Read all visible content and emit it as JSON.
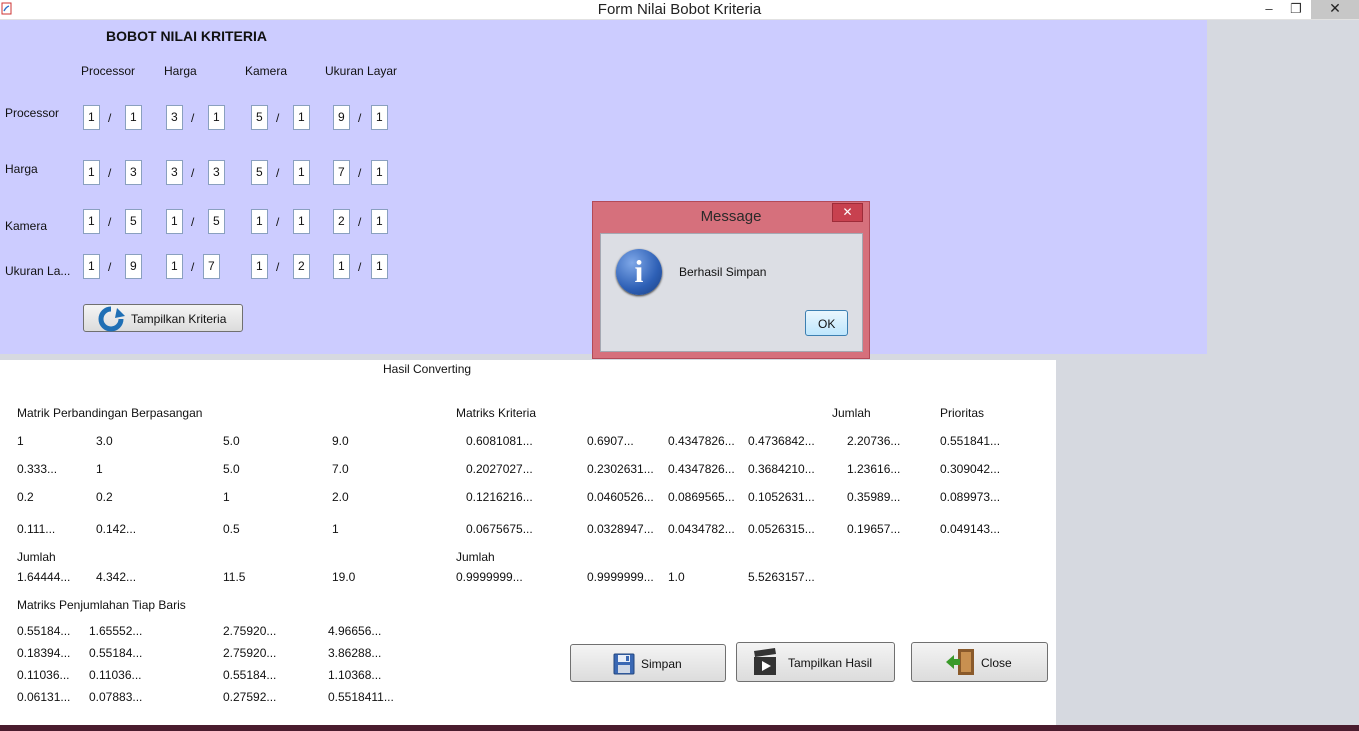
{
  "window": {
    "title": "Form Nilai Bobot Kriteria",
    "minimize": "–",
    "restore": "❐",
    "close": "✕"
  },
  "form": {
    "heading": "BOBOT NILAI KRITERIA",
    "col_headers": [
      "Processor",
      "Harga",
      "Kamera",
      "Ukuran Layar"
    ],
    "row_labels": [
      "Processor",
      "Harga",
      "Kamera",
      "Ukuran La..."
    ],
    "slash": "/",
    "rows": [
      [
        [
          "1",
          "1"
        ],
        [
          "3",
          "1"
        ],
        [
          "5",
          "1"
        ],
        [
          "9",
          "1"
        ]
      ],
      [
        [
          "1",
          "3"
        ],
        [
          "3",
          "3"
        ],
        [
          "5",
          "1"
        ],
        [
          "7",
          "1"
        ]
      ],
      [
        [
          "1",
          "5"
        ],
        [
          "1",
          "5"
        ],
        [
          "1",
          "1"
        ],
        [
          "2",
          "1"
        ]
      ],
      [
        [
          "1",
          "9"
        ],
        [
          "1",
          "7"
        ],
        [
          "1",
          "2"
        ],
        [
          "1",
          "1"
        ]
      ]
    ],
    "tampilkan_kriteria": "Tampilkan Kriteria"
  },
  "hasil": {
    "title": "Hasil Converting",
    "matrik_title": "Matrik Perbandingan Berpasangan",
    "matrik_rows": [
      [
        "1",
        "3.0",
        "5.0",
        "9.0"
      ],
      [
        "0.333...",
        "1",
        "5.0",
        "7.0"
      ],
      [
        "0.2",
        "0.2",
        "1",
        "2.0"
      ],
      [
        "0.111...",
        "0.142...",
        "0.5",
        "1"
      ]
    ],
    "jumlah_label": "Jumlah",
    "matrik_jumlah": [
      "1.64444...",
      "4.342...",
      "11.5",
      "19.0"
    ],
    "penjumlahan_title": "Matriks Penjumlahan Tiap Baris",
    "penjumlahan_rows": [
      [
        "0.55184...",
        "1.65552...",
        "2.75920...",
        "4.96656..."
      ],
      [
        "0.18394...",
        "0.55184...",
        "2.75920...",
        "3.86288..."
      ],
      [
        "0.11036...",
        "0.11036...",
        "0.55184...",
        "1.10368..."
      ],
      [
        "0.06131...",
        "0.07883...",
        "0.27592...",
        "0.5518411..."
      ]
    ],
    "kriteria_title": "Matriks Kriteria",
    "kriteria_jumlah_header": "Jumlah",
    "prioritas_header": "Prioritas",
    "kriteria_rows": [
      [
        "0.6081081...",
        "0.6907...",
        "0.4347826...",
        "0.4736842...",
        "2.20736...",
        "0.551841..."
      ],
      [
        "0.2027027...",
        "0.2302631...",
        "0.4347826...",
        "0.3684210...",
        "1.23616...",
        "0.309042..."
      ],
      [
        "0.1216216...",
        "0.0460526...",
        "0.0869565...",
        "0.1052631...",
        "0.35989...",
        "0.089973..."
      ],
      [
        "0.0675675...",
        "0.0328947...",
        "0.0434782...",
        "0.0526315...",
        "0.19657...",
        "0.049143..."
      ]
    ],
    "kriteria_jumlah_label": "Jumlah",
    "kriteria_jumlah": [
      "0.9999999...",
      "0.9999999...",
      "1.0",
      "5.5263157..."
    ]
  },
  "buttons": {
    "simpan": "Simpan",
    "tampilkan_hasil": "Tampilkan Hasil",
    "close": "Close"
  },
  "dialog": {
    "title": "Message",
    "message": "Berhasil Simpan",
    "ok": "OK",
    "close": "✕",
    "icon_letter": "i"
  },
  "colors": {
    "top_panel": "#ccccff",
    "dialog_frame": "#d6707c",
    "info_icon": "#2d5fb5"
  }
}
